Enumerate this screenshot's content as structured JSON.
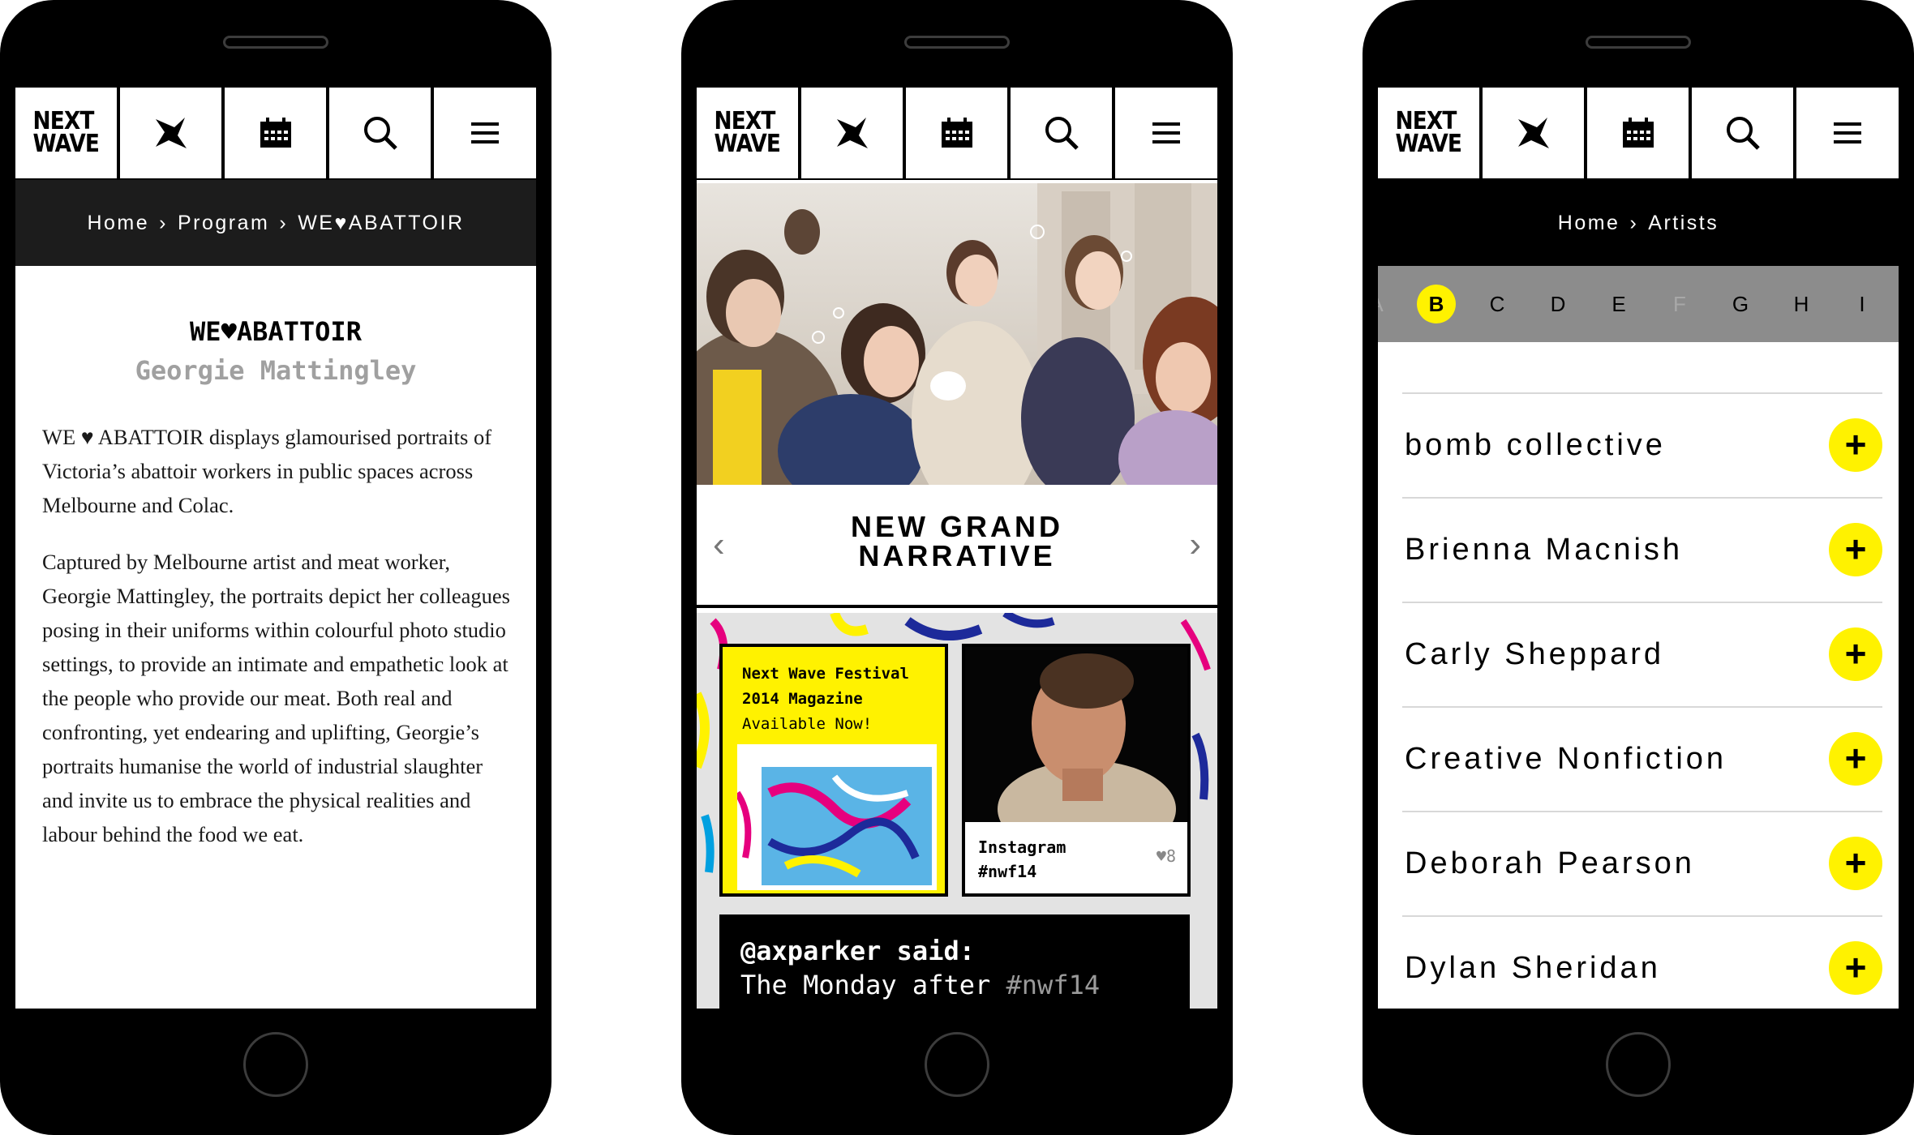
{
  "colors": {
    "accent_yellow": "#fff200",
    "black": "#000000",
    "crumb_grey": "#1c1c1c"
  },
  "nav": {
    "logo_line1": "NEXT",
    "logo_line2": "WAVE",
    "icons": [
      "star-icon",
      "calendar-icon",
      "search-icon",
      "menu-icon"
    ]
  },
  "phone1": {
    "breadcrumb": {
      "home": "Home",
      "sep": "›",
      "program": "Program",
      "current": "WE♥ABATTOIR"
    },
    "title": "WE♥ABATTOIR",
    "artist": "Georgie Mattingley",
    "paragraph1": "WE ♥ ABATTOIR displays glamourised portraits of Victoria’s abattoir workers in public spaces across Melbourne and Colac.",
    "paragraph2": "Captured by Melbourne artist and meat worker, Georgie Mattingley, the portraits depict her colleagues posing in their uniforms within colourful photo studio settings, to provide an intimate and empathetic look at the people who provide our meat. Both real and confronting, yet endearing and uplifting, Georgie’s portraits humanise the world of industrial slaughter and invite us to embrace the physical realities and labour behind the food we eat."
  },
  "phone2": {
    "carousel": {
      "title_line1": "NEW GRAND",
      "title_line2": "NARRATIVE",
      "prev": "‹",
      "next": "›"
    },
    "magazine": {
      "line1": "Next Wave Festival",
      "line2": "2014 Magazine",
      "line3": "Available Now!"
    },
    "instagram": {
      "label": "Instagram",
      "tag": "#nwf14",
      "likes": "8"
    },
    "tweet": {
      "user": "@axparker said:",
      "text": "The Monday after",
      "tag": "#nwf14"
    }
  },
  "phone3": {
    "breadcrumb": {
      "home": "Home",
      "sep": "›",
      "current": "Artists"
    },
    "letters": [
      "A",
      "B",
      "C",
      "D",
      "E",
      "F",
      "G",
      "H",
      "I"
    ],
    "active_letter": "B",
    "disabled_letters": [
      "F"
    ],
    "artists": [
      "bomb collective",
      "Brienna Macnish",
      "Carly Sheppard",
      "Creative Nonfiction",
      "Deborah Pearson",
      "Dylan Sheridan"
    ],
    "expand_symbol": "+"
  }
}
